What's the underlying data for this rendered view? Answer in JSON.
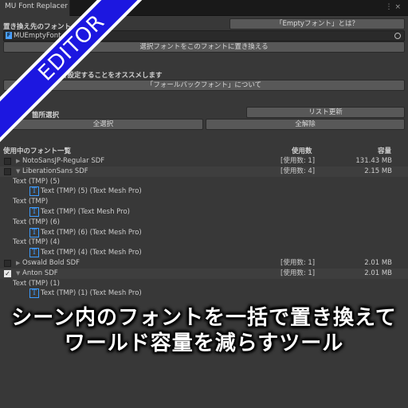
{
  "window": {
    "tab_title": "MU Font Replacer",
    "menu_icon": "kebab-icon",
    "close_icon": "close-icon"
  },
  "replace": {
    "heading": "置き換え先のフォント",
    "help_button": "「Emptyフォント」とは？",
    "field_value": "MUEmptyFont",
    "replace_button": "選択フォントをこのフォントに置き換える"
  },
  "fallback": {
    "note": "を設定することをオススメします",
    "about_button": "「フォールバックフォント」について"
  },
  "selection": {
    "heading": "箇所選択",
    "refresh_button": "リスト更新",
    "select_all": "全選択",
    "deselect_all": "全解除"
  },
  "table": {
    "header": "使用中のフォント一覧",
    "col_count": "使用数",
    "col_size": "容量",
    "rows": [
      {
        "kind": "font",
        "checked": false,
        "expanded": false,
        "name": "NotoSansJP-Regular SDF",
        "count": "[使用数: 1]",
        "size": "131.43 MB"
      },
      {
        "kind": "font",
        "checked": false,
        "expanded": true,
        "name": "LiberationSans SDF",
        "count": "[使用数: 4]",
        "size": "2.15 MB"
      },
      {
        "kind": "obj",
        "name": "Text (TMP) (5)"
      },
      {
        "kind": "comp",
        "name": "Text (TMP) (5) (Text Mesh Pro)"
      },
      {
        "kind": "obj",
        "name": "Text (TMP)"
      },
      {
        "kind": "comp",
        "name": "Text (TMP) (Text Mesh Pro)"
      },
      {
        "kind": "obj",
        "name": "Text (TMP) (6)"
      },
      {
        "kind": "comp",
        "name": "Text (TMP) (6) (Text Mesh Pro)"
      },
      {
        "kind": "obj",
        "name": "Text (TMP) (4)"
      },
      {
        "kind": "comp",
        "name": "Text (TMP) (4) (Text Mesh Pro)"
      },
      {
        "kind": "font",
        "checked": false,
        "expanded": false,
        "name": "Oswald Bold SDF",
        "count": "[使用数: 1]",
        "size": "2.01 MB"
      },
      {
        "kind": "font",
        "checked": true,
        "expanded": true,
        "name": "Anton SDF",
        "count": "[使用数: 1]",
        "size": "2.01 MB"
      },
      {
        "kind": "obj",
        "name": "Text (TMP) (1)"
      },
      {
        "kind": "comp",
        "name": "Text (TMP) (1) (Text Mesh Pro)"
      }
    ]
  },
  "banner": {
    "text": "EDITOR"
  },
  "caption": {
    "line1": "シーン内のフォントを一括で置き換えて",
    "line2": "ワールド容量を減らすツール"
  },
  "colors": {
    "background": "#383838",
    "banner_blue": "#1c17e0",
    "accent_blue": "#3c9cff"
  }
}
